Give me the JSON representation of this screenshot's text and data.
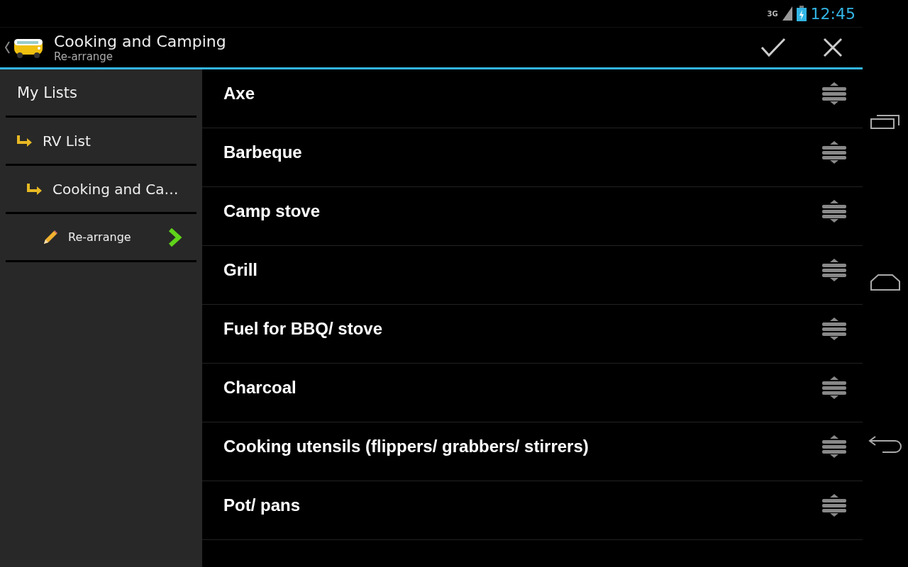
{
  "status_bar": {
    "network": "3G",
    "time": "12:45"
  },
  "action_bar": {
    "title": "Cooking and Camping",
    "subtitle": "Re-arrange"
  },
  "sidebar": {
    "items": [
      {
        "label": "My Lists",
        "kind": "root",
        "children": [
          {
            "label": "RV List",
            "kind": "folder",
            "children": [
              {
                "label": "Cooking and Ca…",
                "kind": "folder",
                "children": [
                  {
                    "label": "Re-arrange",
                    "kind": "action"
                  }
                ]
              }
            ]
          }
        ]
      }
    ]
  },
  "list": {
    "items": [
      {
        "label": "Axe"
      },
      {
        "label": "Barbeque"
      },
      {
        "label": "Camp stove"
      },
      {
        "label": "Grill"
      },
      {
        "label": "Fuel for BBQ/ stove"
      },
      {
        "label": "Charcoal"
      },
      {
        "label": "Cooking utensils (flippers/ grabbers/ stirrers)"
      },
      {
        "label": "Pot/ pans"
      }
    ]
  }
}
